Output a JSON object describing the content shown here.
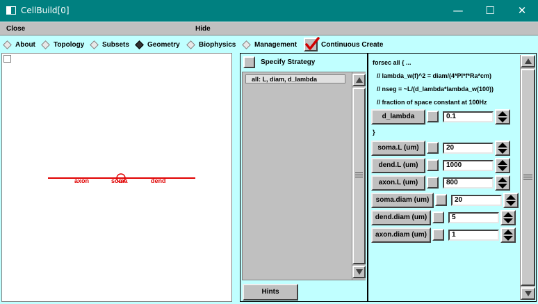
{
  "window": {
    "title": "CellBuild[0]",
    "minimize_glyph": "—",
    "maximize_glyph": "☐",
    "close_glyph": "✕"
  },
  "menu": {
    "close": "Close",
    "hide": "Hide"
  },
  "tabs": [
    {
      "label": "About",
      "selected": false
    },
    {
      "label": "Topology",
      "selected": false
    },
    {
      "label": "Subsets",
      "selected": false
    },
    {
      "label": "Geometry",
      "selected": true
    },
    {
      "label": "Biophysics",
      "selected": false
    },
    {
      "label": "Management",
      "selected": false
    }
  ],
  "continuous_create": {
    "label": "Continuous Create",
    "checked": true
  },
  "canvas": {
    "sections": [
      "axon",
      "soma",
      "dend"
    ],
    "line_color": "#e00000"
  },
  "strategy": {
    "specify_label": "Specify Strategy",
    "list_items": [
      "all:  L, diam, d_lambda"
    ],
    "hints_label": "Hints"
  },
  "params": {
    "header": "forsec all { ...",
    "comments": [
      "// lambda_w(f)^2 = diam/(4*PI*f*Ra*cm)",
      "// nseg = ~L/(d_lambda*lambda_w(100))",
      "// fraction of space constant at 100Hz"
    ],
    "closing": "}",
    "d_lambda": {
      "label": "d_lambda",
      "value": "0.1"
    },
    "fields": [
      {
        "label": "soma.L (um)",
        "value": "20"
      },
      {
        "label": "dend.L (um)",
        "value": "1000"
      },
      {
        "label": "axon.L (um)",
        "value": "800"
      },
      {
        "label": "soma.diam (um)",
        "value": "20"
      },
      {
        "label": "dend.diam (um)",
        "value": "5"
      },
      {
        "label": "axon.diam (um)",
        "value": "1"
      }
    ]
  }
}
